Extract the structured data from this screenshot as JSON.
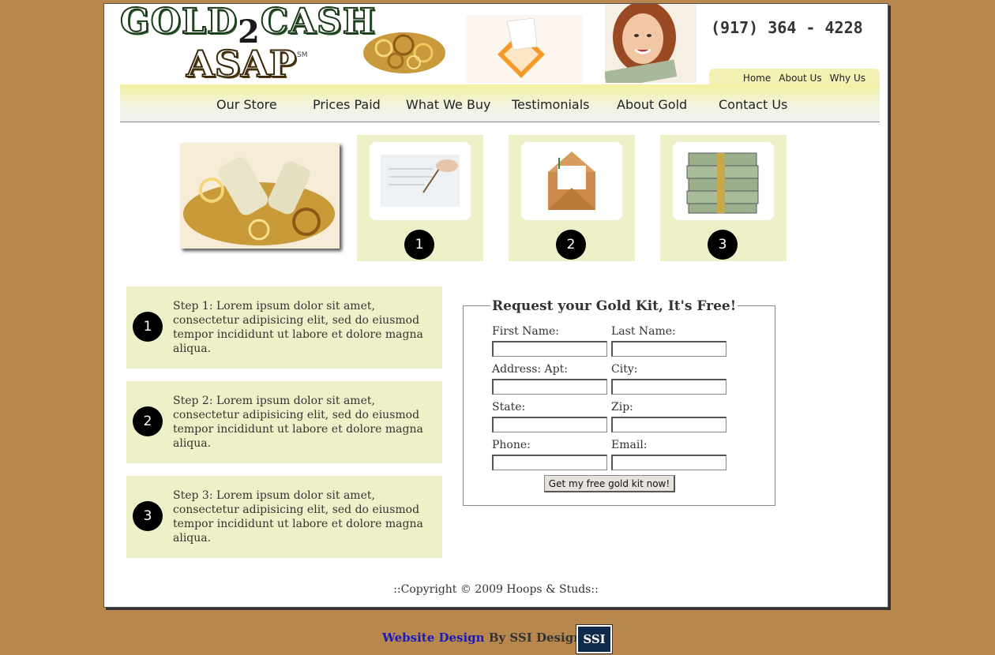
{
  "header": {
    "logo_line1_a": "GOLD",
    "logo_two": "2",
    "logo_line1_b": "CASH",
    "logo_line2": "ASAP",
    "logo_sm": "SM",
    "phone": "(917) 364 - 4228"
  },
  "top_links": [
    "Home",
    "About Us",
    "Why Us"
  ],
  "nav": [
    "Our Store",
    "Prices Paid",
    "What We Buy",
    "Testimonials",
    "About Gold",
    "Contact Us"
  ],
  "step_cards": [
    "1",
    "2",
    "3"
  ],
  "steps": [
    {
      "num": "1",
      "text": "Step 1: Lorem ipsum dolor sit amet, consectetur adipisicing elit, sed do eiusmod tempor incididunt ut labore et dolore magna aliqua."
    },
    {
      "num": "2",
      "text": "Step 2: Lorem ipsum dolor sit amet, consectetur adipisicing elit, sed do eiusmod tempor incididunt ut labore et dolore magna aliqua."
    },
    {
      "num": "3",
      "text": "Step 3: Lorem ipsum dolor sit amet, consectetur adipisicing elit, sed do eiusmod tempor incididunt ut labore et dolore magna aliqua."
    }
  ],
  "form": {
    "legend": "Request your Gold Kit, It's Free!",
    "labels": {
      "first_name": "First Name:",
      "last_name": "Last Name:",
      "address": "Address: Apt:",
      "city": "City:",
      "state": "State:",
      "zip": "Zip:",
      "phone": "Phone:",
      "email": "Email:"
    },
    "values": {
      "first_name": "",
      "last_name": "",
      "address": "",
      "city": "",
      "state": "",
      "zip": "",
      "phone": "",
      "email": ""
    },
    "submit": "Get my free gold kit now!"
  },
  "footer": {
    "copyright": "::Copyright © 2009 Hoops & Studs::",
    "credit_link": "Website Design",
    "credit_by": " By SSI Design",
    "badge": "SSI"
  },
  "colors": {
    "background": "#b8874e",
    "card": "#eef0c8",
    "nav_top": "#f3f1a0",
    "link": "#1a1ab8"
  }
}
